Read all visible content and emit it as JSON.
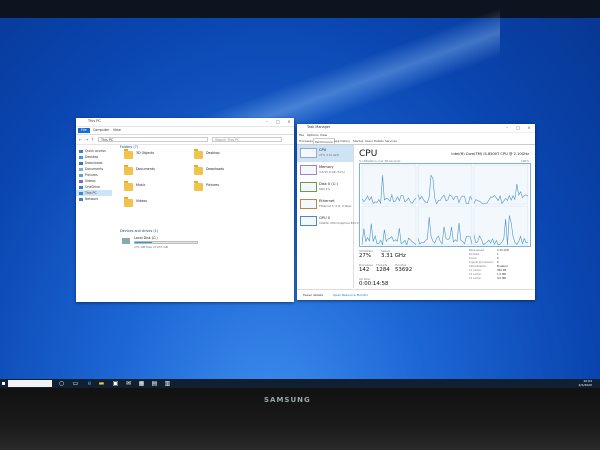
{
  "explorer": {
    "title": "This PC",
    "tabs": [
      "File",
      "Computer",
      "View"
    ],
    "address": "This PC",
    "search_placeholder": "Search This PC",
    "nav": [
      {
        "label": "Quick access",
        "icon": "star-icon"
      },
      {
        "label": "Desktop",
        "icon": "desktop-icon"
      },
      {
        "label": "Downloads",
        "icon": "download-icon"
      },
      {
        "label": "Documents",
        "icon": "document-icon"
      },
      {
        "label": "Pictures",
        "icon": "picture-icon"
      },
      {
        "label": "Videos",
        "icon": "video-icon"
      },
      {
        "label": "OneDrive",
        "icon": "cloud-icon"
      },
      {
        "label": "This PC",
        "icon": "computer-icon"
      },
      {
        "label": "Network",
        "icon": "network-icon"
      }
    ],
    "folders_heading": "Folders (7)",
    "folders": [
      "3D Objects",
      "Desktop",
      "Documents",
      "Downloads",
      "Music",
      "Pictures",
      "Videos"
    ],
    "drives_heading": "Devices and drives (1)",
    "drive": {
      "name": "Local Disk (C:)",
      "free": "171 GB free of 237 GB",
      "used_fraction": 0.28
    }
  },
  "taskmgr": {
    "title": "Task Manager",
    "menu": [
      "File",
      "Options",
      "View"
    ],
    "tabs": [
      "Processes",
      "Performance",
      "App history",
      "Startup",
      "Users",
      "Details",
      "Services"
    ],
    "resources": [
      {
        "name": "CPU",
        "value": "27% 3.31 GHz"
      },
      {
        "name": "Memory",
        "value": "4.9/15.9 GB (31%)"
      },
      {
        "name": "Disk 0 (C:)",
        "value": "SSD\n1%"
      },
      {
        "name": "Ethernet",
        "value": "Ethernet\nS: 0  R: 0 Kbps"
      },
      {
        "name": "GPU 0",
        "value": "Intel(R) UHD Graphics 630\n2%"
      }
    ],
    "heading": "CPU",
    "model": "Intel(R) Core(TM) i5-8500T CPU @ 2.10GHz",
    "util_label": "% Utilization over 60 seconds",
    "util_max": "100%",
    "stats": {
      "utilization_label": "Utilization",
      "utilization": "27%",
      "speed_label": "Speed",
      "speed": "3.31 GHz",
      "processes_label": "Processes",
      "processes": "142",
      "threads_label": "Threads",
      "threads": "1284",
      "handles_label": "Handles",
      "handles": "53692",
      "uptime_label": "Up time",
      "uptime": "0:00:14:58"
    },
    "kv": [
      {
        "k": "Base speed:",
        "v": "2.10 GHz"
      },
      {
        "k": "Sockets:",
        "v": "1"
      },
      {
        "k": "Cores:",
        "v": "6"
      },
      {
        "k": "Logical processors:",
        "v": "6"
      },
      {
        "k": "Virtualization:",
        "v": "Enabled"
      },
      {
        "k": "L1 cache:",
        "v": "384 KB"
      },
      {
        "k": "L2 cache:",
        "v": "1.5 MB"
      },
      {
        "k": "L3 cache:",
        "v": "9.0 MB"
      }
    ],
    "fewer_details": "Fewer details",
    "open_monitor": "Open Resource Monitor"
  },
  "taskbar": {
    "time": "10:04",
    "date": "2/4/2020"
  },
  "monitor_brand": "SAMSUNG",
  "colors": {
    "accent": "#1a6ed1",
    "desktop": "#1c66d4",
    "graph_line": "#4a90c8"
  }
}
